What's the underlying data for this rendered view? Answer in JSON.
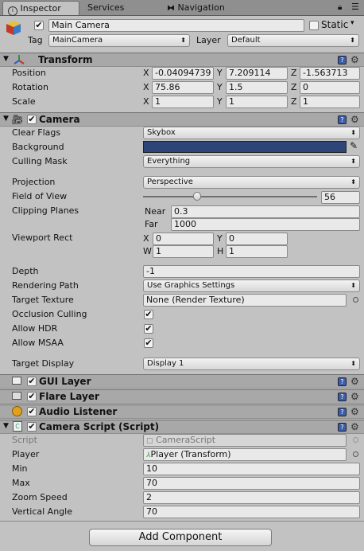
{
  "tabs": [
    {
      "label": "Inspector",
      "icon": "info-icon"
    },
    {
      "label": "Services",
      "icon": ""
    },
    {
      "label": "Navigation",
      "icon": "navigation-icon"
    }
  ],
  "header": {
    "object_name": "Main Camera",
    "static_label": "Static",
    "tag_label": "Tag",
    "tag_value": "MainCamera",
    "layer_label": "Layer",
    "layer_value": "Default"
  },
  "transform": {
    "title": "Transform",
    "position_label": "Position",
    "rotation_label": "Rotation",
    "scale_label": "Scale",
    "axis_x": "X",
    "axis_y": "Y",
    "axis_z": "Z",
    "position": {
      "x": "-0.04094739",
      "y": "7.209114",
      "z": "-1.563713"
    },
    "rotation": {
      "x": "75.86",
      "y": "1.5",
      "z": "0"
    },
    "scale": {
      "x": "1",
      "y": "1",
      "z": "1"
    }
  },
  "camera": {
    "title": "Camera",
    "clear_flags_label": "Clear Flags",
    "clear_flags": "Skybox",
    "background_label": "Background",
    "background_color": "#2e4677",
    "culling_mask_label": "Culling Mask",
    "culling_mask": "Everything",
    "projection_label": "Projection",
    "projection": "Perspective",
    "fov_label": "Field of View",
    "fov": "56",
    "fov_fraction": 0.3,
    "clipping_label": "Clipping Planes",
    "near_label": "Near",
    "near": "0.3",
    "far_label": "Far",
    "far": "1000",
    "viewport_label": "Viewport Rect",
    "vp_x_label": "X",
    "vp_y_label": "Y",
    "vp_w_label": "W",
    "vp_h_label": "H",
    "vp_x": "0",
    "vp_y": "0",
    "vp_w": "1",
    "vp_h": "1",
    "depth_label": "Depth",
    "depth": "-1",
    "rendering_path_label": "Rendering Path",
    "rendering_path": "Use Graphics Settings",
    "target_texture_label": "Target Texture",
    "target_texture": "None (Render Texture)",
    "occlusion_label": "Occlusion Culling",
    "hdr_label": "Allow HDR",
    "msaa_label": "Allow MSAA",
    "target_display_label": "Target Display",
    "target_display": "Display 1"
  },
  "components": {
    "gui_layer": "GUI Layer",
    "flare_layer": "Flare Layer",
    "audio_listener": "Audio Listener"
  },
  "camera_script": {
    "title": "Camera Script (Script)",
    "script_label": "Script",
    "script_value": "CameraScript",
    "player_label": "Player",
    "player_value": "Player (Transform)",
    "min_label": "Min",
    "min": "10",
    "max_label": "Max",
    "max": "70",
    "zoom_label": "Zoom Speed",
    "zoom": "2",
    "vangle_label": "Vertical Angle",
    "vangle": "70"
  },
  "add_component": "Add Component",
  "icons": {
    "help": "help-icon",
    "gear": "gear-icon",
    "eyedropper": "eyedropper-icon",
    "cube": "gameobject-cube-icon",
    "lock": "lock-icon",
    "menu": "menu-icon"
  }
}
